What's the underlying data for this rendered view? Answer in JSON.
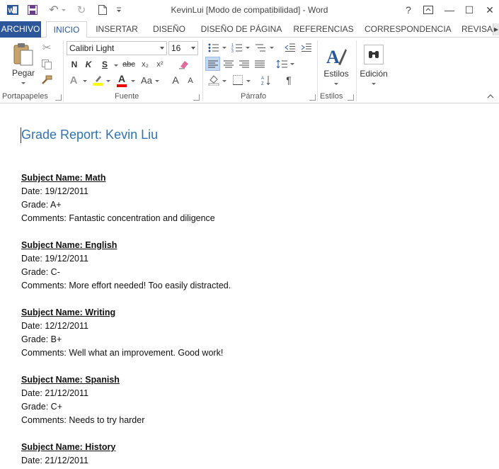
{
  "window": {
    "title": "KevinLui [Modo de compatibilidad] - Word",
    "help": "?",
    "minimize": "—",
    "maximize": "☐",
    "close": "✕",
    "undo_icon": "↶",
    "redo_icon": "↻"
  },
  "tabs": [
    {
      "label": "ARCHIVO"
    },
    {
      "label": "INICIO"
    },
    {
      "label": "INSERTAR"
    },
    {
      "label": "DISEÑO"
    },
    {
      "label": "DISEÑO DE PÁGINA"
    },
    {
      "label": "REFERENCIAS"
    },
    {
      "label": "CORRESPONDENCIA"
    },
    {
      "label": "REVISA"
    }
  ],
  "ribbon": {
    "clipboard": {
      "label": "Portapapeles",
      "paste": "Pegar"
    },
    "font": {
      "label": "Fuente",
      "font_name": "Calibri Light",
      "font_size": "16",
      "bold": "N",
      "italic": "K",
      "underline": "S",
      "strike": "abc",
      "subscript": "x₂",
      "superscript": "x²",
      "font_color": "A",
      "case": "Aa",
      "grow": "A",
      "shrink": "A"
    },
    "paragraph": {
      "label": "Párrafo",
      "pilcrow": "¶"
    },
    "styles": {
      "label": "Estilos",
      "button": "Estilos"
    },
    "editing": {
      "button": "Edición"
    }
  },
  "document": {
    "title": "Grade Report: Kevin Liu",
    "entries": [
      {
        "subject": "Subject Name: Math",
        "date": "Date: 19/12/2011",
        "grade": "Grade: A+",
        "comments": "Comments: Fantastic concentration and diligence"
      },
      {
        "subject": "Subject Name: English",
        "date": "Date: 19/12/2011",
        "grade": "Grade: C-",
        "comments": "Comments: More effort needed! Too easily distracted."
      },
      {
        "subject": "Subject Name: Writing",
        "date": "Date: 12/12/2011",
        "grade": "Grade: B+",
        "comments": "Comments: Well what an improvement. Good work!"
      },
      {
        "subject": "Subject Name: Spanish",
        "date": "Date: 21/12/2011",
        "grade": "Grade: C+",
        "comments": "Comments: Needs to try harder"
      },
      {
        "subject": "Subject Name: History",
        "date": "Date: 21/12/2011"
      }
    ]
  },
  "colors": {
    "accent": "#2b579a",
    "heading": "#2e74b5"
  }
}
